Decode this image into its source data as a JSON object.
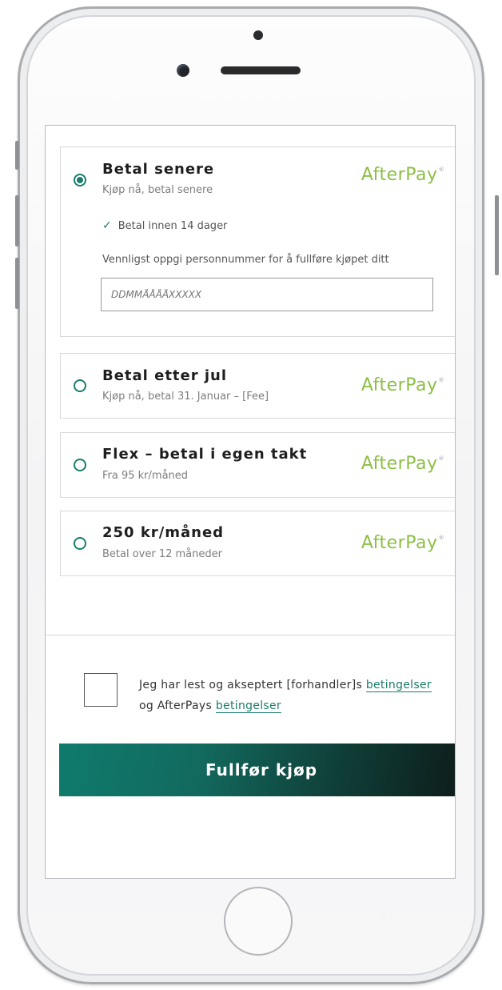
{
  "options": [
    {
      "title": "Betal senere",
      "subtitle": "Kjøp nå, betal senere",
      "brand": "AfterPay",
      "brand_mark": "®",
      "selected": true,
      "detail": {
        "check_text": "Betal innen 14 dager",
        "instruction": "Vennligst oppgi personnummer for å fullføre kjøpet ditt",
        "input_placeholder": "DDMMÅÅÅÅXXXXX",
        "input_value": ""
      }
    },
    {
      "title": "Betal etter jul",
      "subtitle": "Kjøp nå, betal 31. Januar – [Fee]",
      "brand": "AfterPay",
      "brand_mark": "®",
      "selected": false
    },
    {
      "title": "Flex – betal i egen takt",
      "subtitle": "Fra 95 kr/måned",
      "brand": "AfterPay",
      "brand_mark": "®",
      "selected": false
    },
    {
      "title": "250 kr/måned",
      "subtitle": "Betal over 12 måneder",
      "brand": "AfterPay",
      "brand_mark": "®",
      "selected": false
    }
  ],
  "terms": {
    "text_1": "Jeg har lest og akseptert [forhandler]s",
    "link_1": "betingelser",
    "text_2": "og AfterPays",
    "link_2": "betingelser",
    "checked": false
  },
  "cta_label": "Fullfør kjøp",
  "colors": {
    "accent": "#197c6c",
    "brand_green": "#8cbf45",
    "cta_start": "#0f7b6d",
    "cta_end": "#0e1c1a"
  },
  "icons": {
    "check": "check-icon"
  }
}
